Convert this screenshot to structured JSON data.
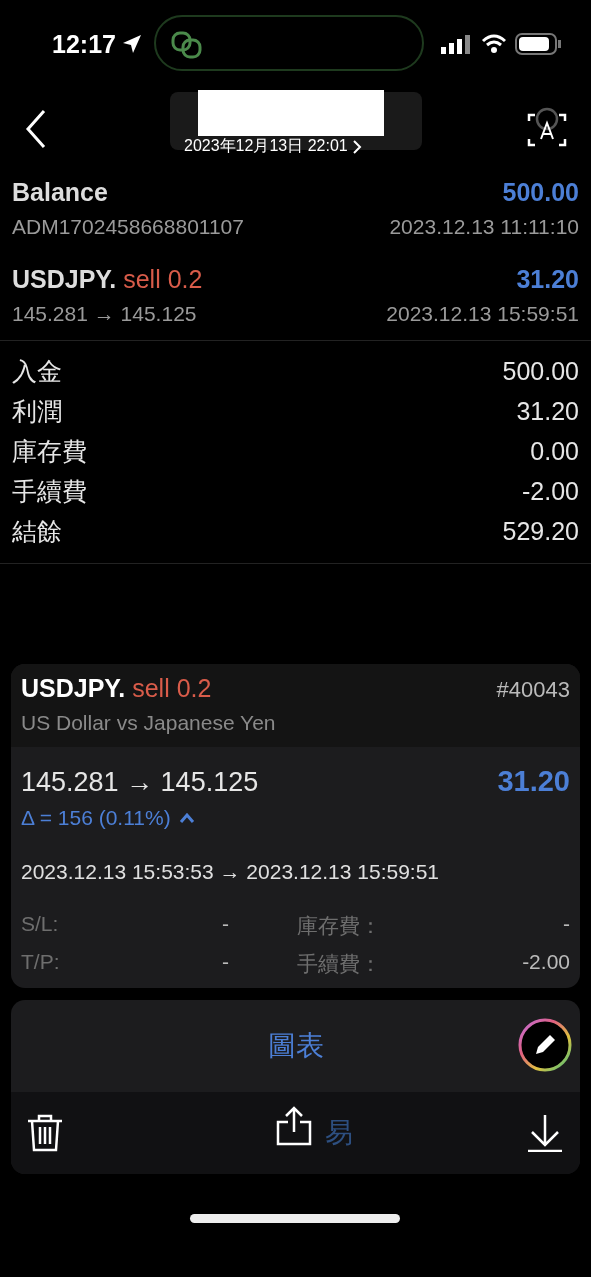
{
  "status_bar": {
    "time": "12:17"
  },
  "header": {
    "date": "2023年12月13日 22:01"
  },
  "history": [
    {
      "kind": "balance",
      "title": "Balance",
      "amount": "500.00",
      "sub": "ADM1702458668801107",
      "time": "2023.12.13 11:11:10"
    },
    {
      "kind": "trade",
      "symbol": "USDJPY.",
      "side": "sell 0.2",
      "amount": "31.20",
      "sub": "145.281 → 145.125",
      "time": "2023.12.13 15:59:51"
    }
  ],
  "summary": [
    {
      "label": "入金",
      "value": "500.00"
    },
    {
      "label": "利潤",
      "value": "31.20"
    },
    {
      "label": "庫存費",
      "value": "0.00"
    },
    {
      "label": "手續費",
      "value": "-2.00"
    },
    {
      "label": "結餘",
      "value": "529.20"
    }
  ],
  "detail": {
    "symbol": "USDJPY.",
    "side": "sell 0.2",
    "ticket": "#40043",
    "description": "US Dollar vs Japanese Yen",
    "prices": "145.281 → 145.125",
    "profit": "31.20",
    "delta": "Δ = 156 (0.11%)",
    "expanded": true,
    "times": "2023.12.13 15:53:53 → 2023.12.13 15:59:51",
    "fields": [
      {
        "label": "S/L:",
        "value": "-"
      },
      {
        "label": "庫存費：",
        "value": "-"
      },
      {
        "label": "T/P:",
        "value": "-"
      },
      {
        "label": "手續費：",
        "value": "-2.00"
      }
    ]
  },
  "actions": {
    "primary": "圖表",
    "secondary": "易"
  }
}
